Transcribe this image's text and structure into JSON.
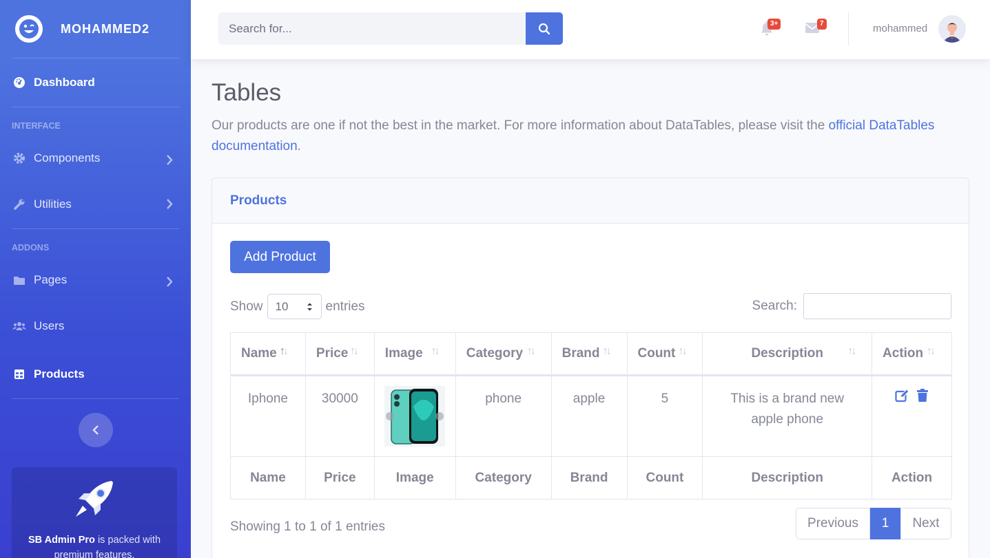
{
  "brand": {
    "name": "MOHAMMED2"
  },
  "sidebar": {
    "dashboard": "Dashboard",
    "heading_interface": "INTERFACE",
    "components": "Components",
    "utilities": "Utilities",
    "heading_addons": "ADDONS",
    "pages": "Pages",
    "users": "Users",
    "products": "Products",
    "promo_bold": "SB Admin Pro",
    "promo_text": " is packed with premium features,"
  },
  "topbar": {
    "search_placeholder": "Search for...",
    "alerts_badge": "3+",
    "messages_badge": "7",
    "username": "mohammed"
  },
  "page": {
    "title": "Tables",
    "description": "Our products are one if not the best in the market. For more information about DataTables, please visit the ",
    "link_text": "official DataTables documentation",
    "description_end": "."
  },
  "card": {
    "title": "Products",
    "add_button": "Add Product",
    "show_label": "Show",
    "entries_value": "10",
    "entries_label": "entries",
    "search_label": "Search:"
  },
  "table": {
    "columns": [
      "Name",
      "Price",
      "Image",
      "Category",
      "Brand",
      "Count",
      "Description",
      "Action"
    ],
    "rows": [
      {
        "name": "Iphone",
        "price": "30000",
        "category": "phone",
        "brand": "apple",
        "count": "5",
        "description": "This is a brand new apple phone"
      }
    ]
  },
  "footer": {
    "info": "Showing 1 to 1 of 1 entries",
    "previous": "Previous",
    "current_page": "1",
    "next": "Next"
  },
  "colors": {
    "primary": "#4e73df",
    "danger": "#e74a3b",
    "text": "#858796"
  }
}
